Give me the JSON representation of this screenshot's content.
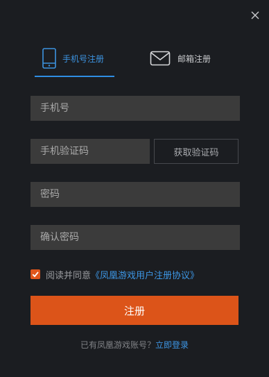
{
  "tabs": [
    {
      "label": "手机号注册",
      "icon": "phone-icon",
      "active": true
    },
    {
      "label": "邮箱注册",
      "icon": "mail-icon",
      "active": false
    }
  ],
  "form": {
    "phone_placeholder": "手机号",
    "code_placeholder": "手机验证码",
    "code_button": "获取验证码",
    "password_placeholder": "密码",
    "confirm_placeholder": "确认密码"
  },
  "agreement": {
    "checked": true,
    "text": "阅读并同意",
    "link": "《凤凰游戏用户注册协议》"
  },
  "submit_label": "注册",
  "footer": {
    "text": "已有凤凰游戏账号？",
    "link": "立即登录"
  },
  "colors": {
    "background": "#1b1d21",
    "accent_blue": "#3c93e0",
    "accent_orange": "#dc5419",
    "field_bg": "#3b3b3b"
  }
}
